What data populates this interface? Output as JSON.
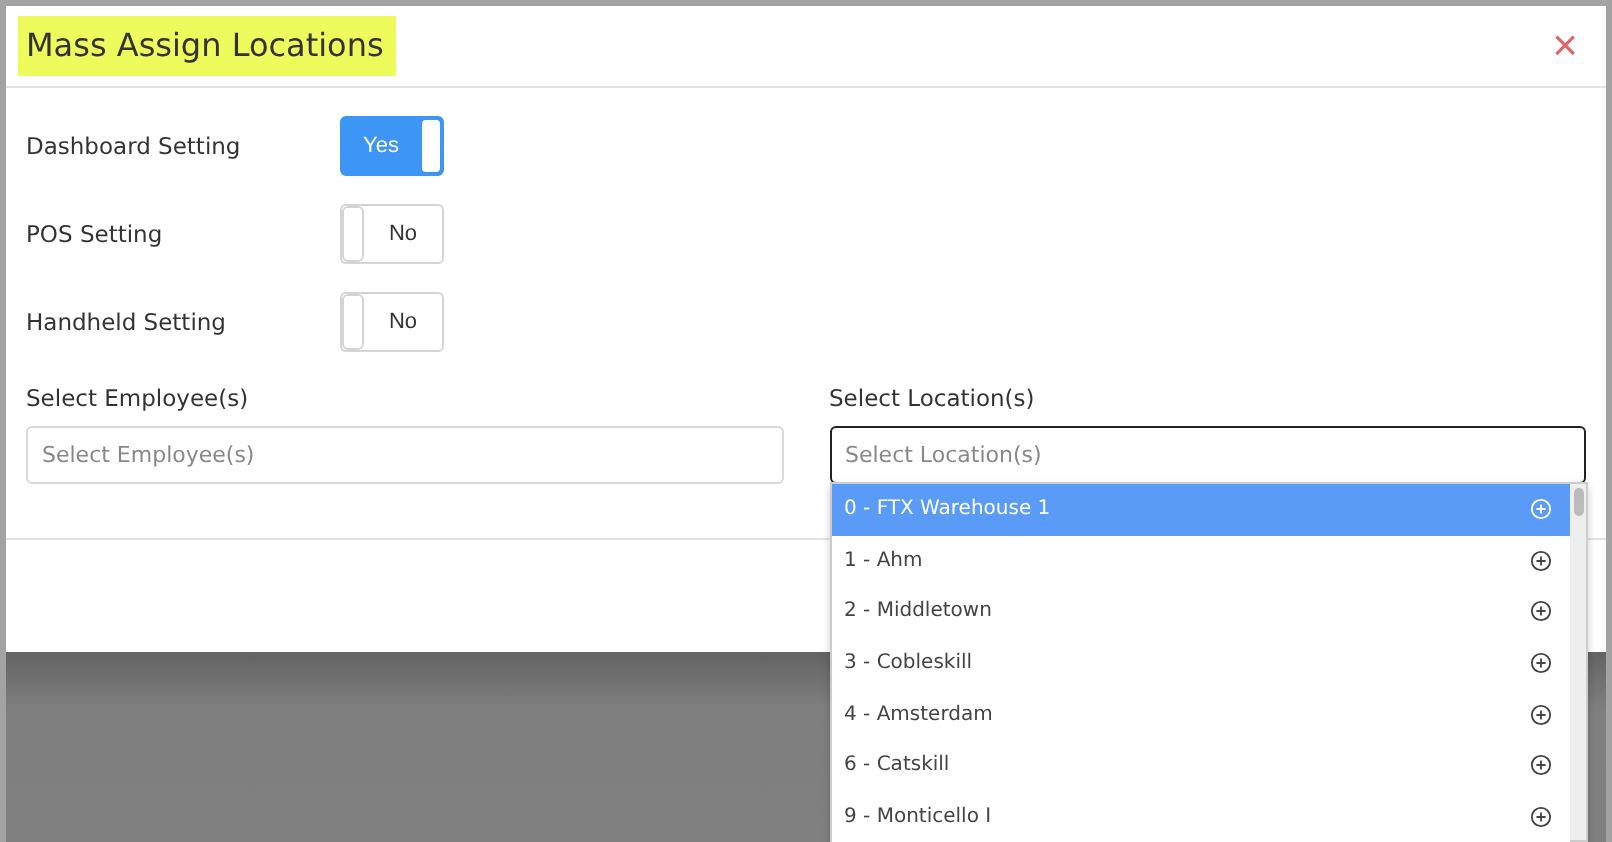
{
  "dialog": {
    "title": "Mass Assign Locations",
    "close": "×"
  },
  "settings": [
    {
      "label": "Dashboard Setting",
      "on": true,
      "text": "Yes"
    },
    {
      "label": "POS Setting",
      "on": false,
      "text": "No"
    },
    {
      "label": "Handheld Setting",
      "on": false,
      "text": "No"
    }
  ],
  "employee": {
    "label": "Select Employee(s)",
    "placeholder": "Select Employee(s)"
  },
  "location": {
    "label": "Select Location(s)",
    "placeholder": "Select Location(s)",
    "focused": true,
    "options": [
      {
        "label": "0 - FTX Warehouse 1",
        "selected": true
      },
      {
        "label": "1 - Ahm",
        "selected": false
      },
      {
        "label": "2 - Middletown",
        "selected": false
      },
      {
        "label": "3 - Cobleskill",
        "selected": false
      },
      {
        "label": "4 - Amsterdam",
        "selected": false
      },
      {
        "label": "6 - Catskill",
        "selected": false
      },
      {
        "label": "9 - Monticello I",
        "selected": false
      }
    ]
  }
}
